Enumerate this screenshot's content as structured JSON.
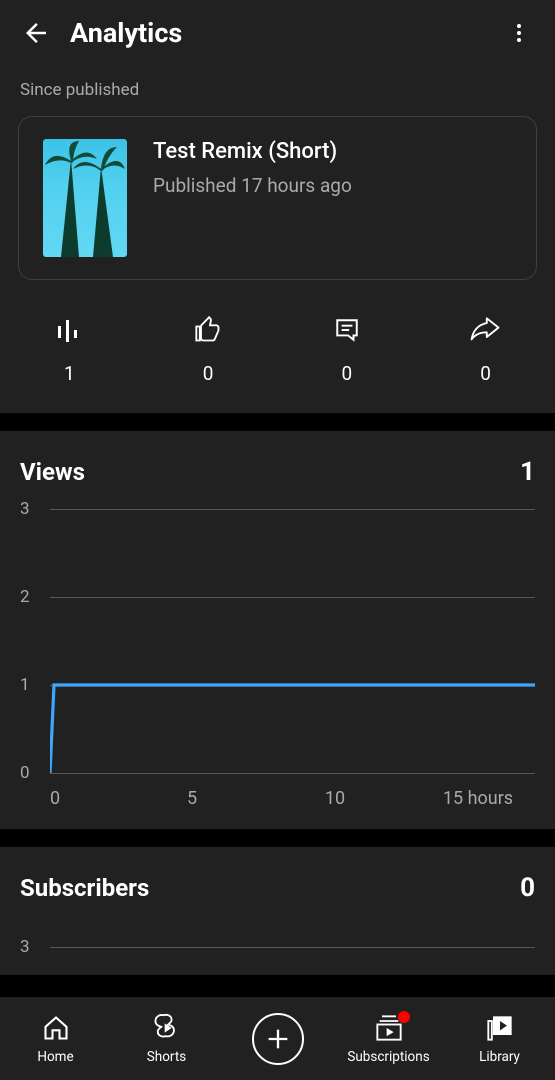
{
  "header": {
    "title": "Analytics"
  },
  "since_label": "Since published",
  "video": {
    "title": "Test Remix (Short)",
    "published": "Published 17 hours ago"
  },
  "stats": {
    "views": "1",
    "likes": "0",
    "comments": "0",
    "shares": "0"
  },
  "views_section": {
    "title": "Views",
    "value": "1"
  },
  "subs_section": {
    "title": "Subscribers",
    "value": "0"
  },
  "chart_data": [
    {
      "type": "line",
      "title": "Views",
      "x": [
        0,
        1,
        5,
        10,
        15
      ],
      "y": [
        0,
        1,
        1,
        1,
        1
      ],
      "xlabel": "hours",
      "ylabel": "",
      "ylim": [
        0,
        3
      ],
      "xlim": [
        0,
        17
      ],
      "xticks": [
        0,
        5,
        10,
        15
      ],
      "yticks": [
        0,
        1,
        2,
        3
      ],
      "xtick_suffix_last": " hours"
    },
    {
      "type": "line",
      "title": "Subscribers",
      "x": [],
      "y": [],
      "ylim": [
        0,
        3
      ],
      "yticks": [
        3
      ]
    }
  ],
  "nav": {
    "home": "Home",
    "shorts": "Shorts",
    "subscriptions": "Subscriptions",
    "library": "Library"
  }
}
